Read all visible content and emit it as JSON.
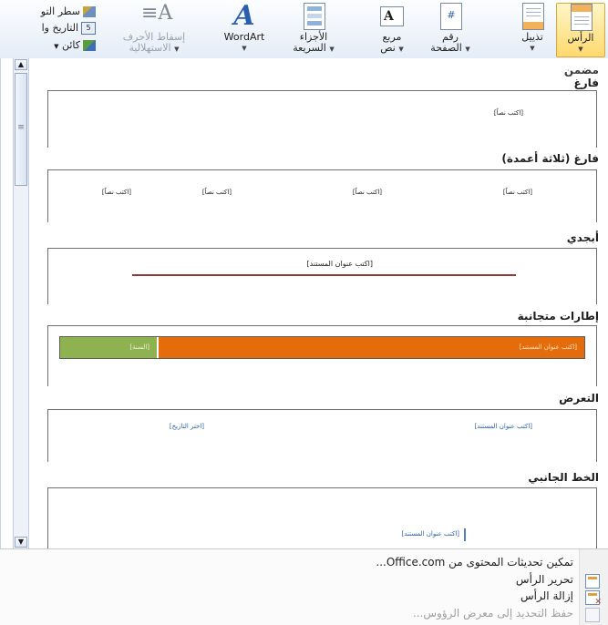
{
  "ribbon": {
    "header_btn": "الرأس",
    "footer_btn": "تذييل",
    "page_number_btn": [
      "رقم",
      "الصفحة"
    ],
    "textbox_btn": [
      "مربع",
      "نص"
    ],
    "quick_parts_btn": [
      "الأجزاء",
      "السريعة"
    ],
    "wordart_btn": "WordArt",
    "dropcap_btn": [
      "إسقاط الأحرف",
      "الاستهلالية"
    ],
    "small": {
      "signature_line": "سطر التو",
      "date_time": "التاريخ وا",
      "object": "كائن"
    },
    "icons": {
      "header": "header-page-icon",
      "footer": "footer-page-icon",
      "page_number": "page-number-icon",
      "textbox": "textbox-icon",
      "quick_parts": "quick-parts-icon",
      "wordart": "wordart-icon",
      "dropcap": "dropcap-icon"
    }
  },
  "gallery": {
    "category": "مضمن",
    "items": [
      {
        "title": "فارغ",
        "placeholders": [
          "[اكتب نصاً]"
        ]
      },
      {
        "title": "فارغ (ثلاثة أعمدة)",
        "placeholders": [
          "[اكتب نصاً]",
          "[اكتب نصاً]",
          "[اكتب نصاً]",
          "[اكتب نصاً]"
        ]
      },
      {
        "title": "أبجدي",
        "placeholders": [
          "[اكتب عنوان المستند]"
        ]
      },
      {
        "title": "إطارات متجانبة",
        "placeholders": [
          "[اكتب عنوان المستند]",
          "[السنة]"
        ]
      },
      {
        "title": "التعرض",
        "placeholders": [
          "[اكتب عنوان المستند]",
          "[اختر التاريخ]"
        ]
      },
      {
        "title": "الخط الجانبي",
        "placeholders": [
          "[اكتب عنوان المستند]"
        ]
      }
    ],
    "colors": {
      "tiles_orange": "#e46c0a",
      "tiles_green": "#8db24f",
      "alphabet_line": "#943634",
      "accent_blue": "#4f81bd"
    }
  },
  "menu": {
    "items": [
      {
        "label": "تمكين تحديثات المحتوى من Office.com...",
        "enabled": true
      },
      {
        "label": "تحرير الرأس",
        "enabled": true
      },
      {
        "label": "إزالة الرأس",
        "enabled": true
      },
      {
        "label": "حفظ التحديد إلى معرض الرؤوس...",
        "enabled": false
      }
    ]
  }
}
